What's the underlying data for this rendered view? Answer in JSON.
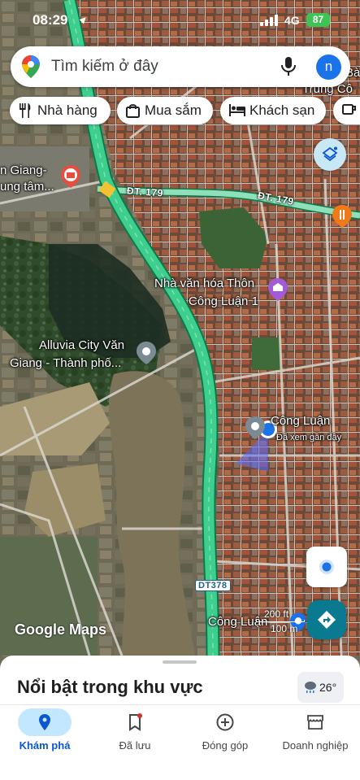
{
  "status_bar": {
    "time": "08:29",
    "network": "4G",
    "battery": "87"
  },
  "search": {
    "placeholder": "Tìm kiếm ở đây",
    "avatar_letter": "n"
  },
  "chips": [
    {
      "label": "Nhà hàng",
      "icon": "restaurant-icon"
    },
    {
      "label": "Mua sắm",
      "icon": "shopping-bag-icon"
    },
    {
      "label": "Khách sạn",
      "icon": "hotel-bed-icon"
    },
    {
      "label": "",
      "icon": "coffee-icon"
    }
  ],
  "map": {
    "labels": {
      "van_giang": "n Giang-",
      "trung_tam": "ung tâm...",
      "nha_van_hoa_1": "Nhà văn hóa Thôn",
      "nha_van_hoa_2": "Công Luận 1",
      "alluvia_1": "Alluvia City Văn",
      "alluvia_2": "Giang - Thành phố...",
      "cong_luan": "Công Luận",
      "da_xem": "Đã xem gần đây",
      "cong_luan_bottom": "Công Luận",
      "top_right_1": "Bà",
      "top_right_2": "Trung Cô"
    },
    "roads": {
      "dt179_a": "ĐT. 179",
      "dt179_b": "ĐT. 179",
      "dt378": "DT378"
    },
    "google_logo": "Google Maps",
    "scale_top": "200 ft",
    "scale_bottom": "100 m",
    "colors": {
      "highway": "#3ecf8e",
      "secondary_road": "#8fe0b8",
      "user_location": "#1a73e8"
    }
  },
  "sheet": {
    "title": "Nổi bật trong khu vực",
    "weather_temp": "26°"
  },
  "nav": [
    {
      "label": "Khám phá",
      "icon": "explore-pin-icon",
      "active": true
    },
    {
      "label": "Đã lưu",
      "icon": "bookmark-icon",
      "active": false
    },
    {
      "label": "Đóng góp",
      "icon": "add-circle-icon",
      "active": false
    },
    {
      "label": "Doanh nghiệp",
      "icon": "storefront-icon",
      "active": false
    }
  ]
}
